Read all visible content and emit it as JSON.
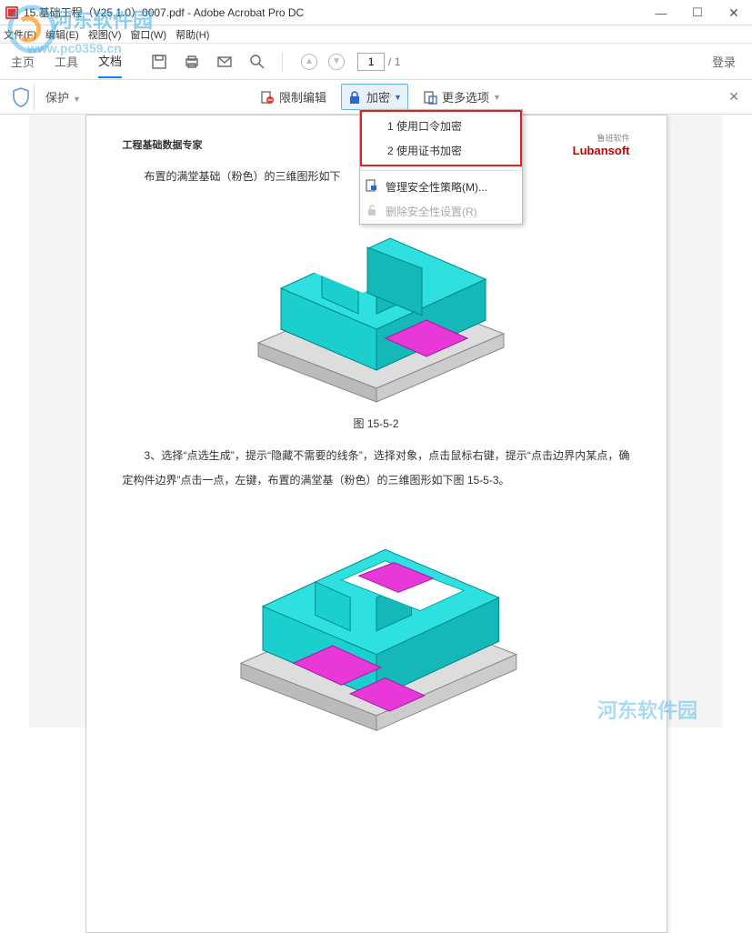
{
  "window": {
    "title": "15.基础工程（V25.1.0）0007.pdf - Adobe Acrobat Pro DC",
    "min": "—",
    "max": "☐",
    "close": "✕"
  },
  "menu": {
    "file": "文件(F)",
    "edit": "编辑(E)",
    "view": "视图(V)",
    "window": "窗口(W)",
    "help": "帮助(H)"
  },
  "tabs": {
    "home": "主页",
    "tools": "工具",
    "doc": "文档"
  },
  "paging": {
    "current": "1",
    "total": "/ 1"
  },
  "login": "登录",
  "protect_bar": {
    "label": "保护",
    "restrict": "限制编辑",
    "encrypt": "加密",
    "more": "更多选项"
  },
  "popup": {
    "opt1": "1 使用口令加密",
    "opt2": "2 使用证书加密",
    "manage": "管理安全性策略(M)...",
    "remove": "删除安全性设置(R)"
  },
  "document": {
    "header_left": "工程基础数据专家",
    "header_logo_sub": "鲁班软件",
    "header_logo": "Lubansoft",
    "para1": "布置的满堂基础（粉色）的三维图形如下",
    "fig1_caption": "图 15-5-2",
    "para2": "3、选择“点选生成”，提示“隐藏不需要的线条”，选择对象，点击鼠标右键，提示“点击边界内某点，确定构件边界”点击一点，左键，布置的满堂基（粉色）的三维图形如下图 15-5-3。"
  },
  "watermark": {
    "name": "河东软件园",
    "url": "www.pc0359.cn"
  }
}
